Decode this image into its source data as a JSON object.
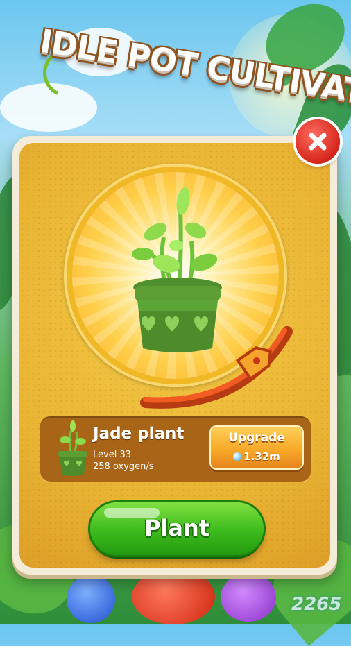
{
  "game": {
    "title": "IDLE POT CULTIVATE"
  },
  "plant_panel": {
    "close_icon": "close-x-icon",
    "plant": {
      "name": "Jade plant",
      "level": "Level 33",
      "rate": "258 oxygen/s"
    },
    "upgrade": {
      "label": "Upgrade",
      "cost": "1.32m",
      "currency_icon": "oxygen-bubble-icon"
    },
    "plant_button": {
      "label": "Plant"
    }
  },
  "watermark": {
    "text": "2265"
  },
  "colors": {
    "panel": "#eab534",
    "close": "#d6261c",
    "upgrade": "#f7a929",
    "plant_button": "#3cba1c",
    "info_card": "#a86518"
  }
}
